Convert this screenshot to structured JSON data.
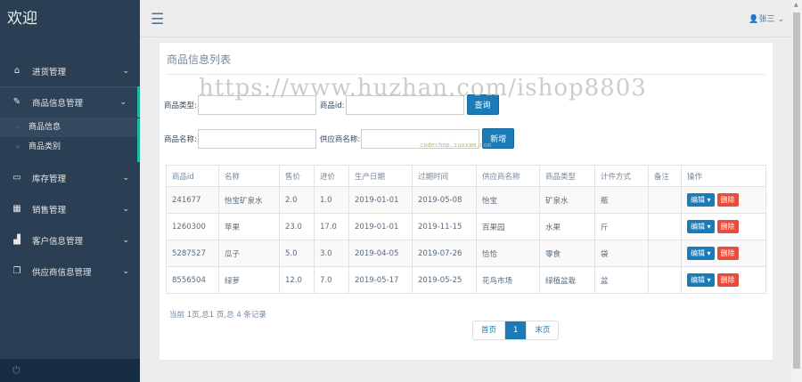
{
  "sidebar": {
    "brand": "欢迎",
    "items": [
      {
        "icon": "home-icon",
        "glyph": "⌂",
        "label": "进货管理"
      },
      {
        "icon": "edit-icon",
        "glyph": "✎",
        "label": "商品信息管理",
        "sub": [
          "商品信息",
          "商品类别"
        ]
      },
      {
        "icon": "desktop-icon",
        "glyph": "▭",
        "label": "库存管理"
      },
      {
        "icon": "table-icon",
        "glyph": "▦",
        "label": "销售管理"
      },
      {
        "icon": "bar-chart-icon",
        "glyph": "▟",
        "label": "客户信息管理"
      },
      {
        "icon": "clone-icon",
        "glyph": "❐",
        "label": "供应商信息管理"
      }
    ]
  },
  "header": {
    "user": "张三"
  },
  "panel": {
    "title": "商品信息列表",
    "filters": {
      "type_label": "商品类型:",
      "id_label": "商品id:",
      "name_label": "商品名称:",
      "supplier_label": "供应商名称:",
      "query": "查询",
      "add": "新增"
    },
    "watermark": "https://www.huzhan.com/ishop8803",
    "watermark2": "codechop.iuoxam.com",
    "columns": [
      "商品id",
      "名称",
      "售价",
      "进价",
      "生产日期",
      "过期时间",
      "供应商名称",
      "商品类型",
      "计件方式",
      "备注",
      "操作"
    ],
    "rows": [
      [
        "241677",
        "怡宝矿泉水",
        "2.0",
        "1.0",
        "2019-01-01",
        "2019-05-08",
        "怡宝",
        "矿泉水",
        "瓶",
        ""
      ],
      [
        "1260300",
        "苹果",
        "23.0",
        "17.0",
        "2019-01-01",
        "2019-11-15",
        "百果园",
        "水果",
        "斤",
        ""
      ],
      [
        "5287527",
        "瓜子",
        "5.0",
        "3.0",
        "2019-04-05",
        "2019-07-26",
        "恰恰",
        "零食",
        "袋",
        ""
      ],
      [
        "8556504",
        "绿萝",
        "12.0",
        "7.0",
        "2019-05-17",
        "2019-05-25",
        "花鸟市场",
        "绿植盆栽",
        "盆",
        ""
      ]
    ],
    "edit": "编辑",
    "delete": "删除",
    "page_info": "当前 1页,总1 页,总 4 条记录",
    "pager": [
      "首页",
      "1",
      "末页"
    ]
  }
}
